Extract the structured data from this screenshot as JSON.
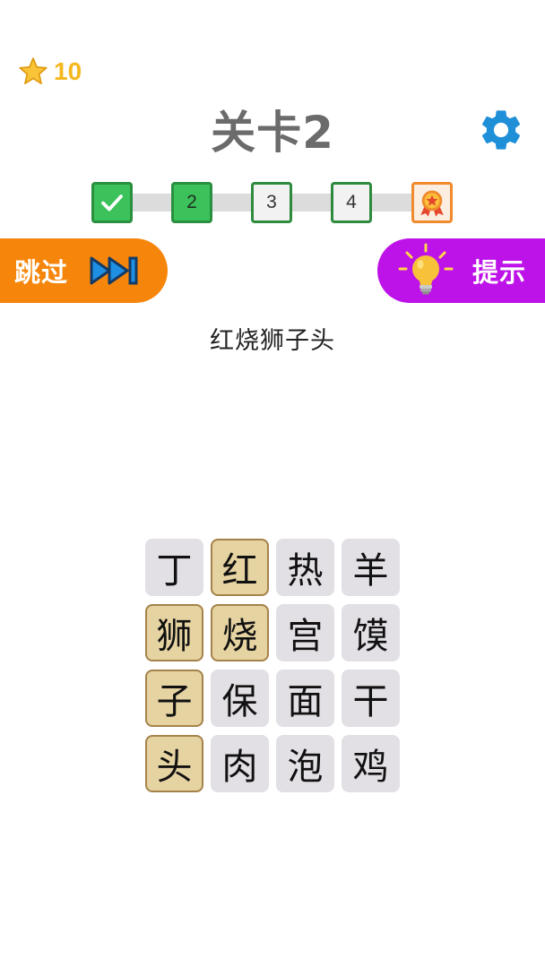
{
  "header": {
    "star_count": "10",
    "title": "关卡2"
  },
  "progress": {
    "steps": [
      {
        "label": "",
        "state": "done"
      },
      {
        "label": "2",
        "state": "current"
      },
      {
        "label": "3",
        "state": "todo"
      },
      {
        "label": "4",
        "state": "todo"
      },
      {
        "label": "",
        "state": "reward"
      }
    ]
  },
  "buttons": {
    "skip_label": "跳过",
    "hint_label": "提示"
  },
  "puzzle": {
    "target_word": "红烧狮子头",
    "tiles": [
      {
        "char": "丁",
        "selected": false
      },
      {
        "char": "红",
        "selected": true
      },
      {
        "char": "热",
        "selected": false
      },
      {
        "char": "羊",
        "selected": false
      },
      {
        "char": "狮",
        "selected": true
      },
      {
        "char": "烧",
        "selected": true
      },
      {
        "char": "宫",
        "selected": false
      },
      {
        "char": "馍",
        "selected": false
      },
      {
        "char": "子",
        "selected": true
      },
      {
        "char": "保",
        "selected": false
      },
      {
        "char": "面",
        "selected": false
      },
      {
        "char": "干",
        "selected": false
      },
      {
        "char": "头",
        "selected": true
      },
      {
        "char": "肉",
        "selected": false
      },
      {
        "char": "泡",
        "selected": false
      },
      {
        "char": "鸡",
        "selected": false
      }
    ]
  },
  "colors": {
    "skip_button": "#f6860b",
    "hint_button": "#bd12e8",
    "step_green": "#3bc25a",
    "star": "#f5b71e",
    "gear": "#1f8fd8",
    "tile_selected": "#e6d3a2",
    "tile_default": "#e2dfe5"
  },
  "icons": {
    "star": "star-icon",
    "settings": "gear-icon",
    "skip": "fast-forward-icon",
    "hint": "lightbulb-icon",
    "done": "checkmark-icon",
    "reward": "medal-icon"
  }
}
